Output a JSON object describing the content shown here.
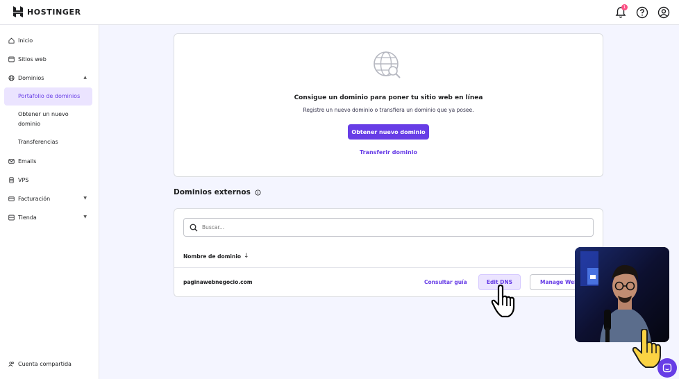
{
  "brand": {
    "name": "HOSTINGER"
  },
  "header": {
    "notification_count": "1",
    "icons": [
      "bell-icon",
      "help-icon",
      "account-icon"
    ]
  },
  "sidebar": {
    "items": [
      {
        "label": "Inicio",
        "icon": "home-icon"
      },
      {
        "label": "Sitios web",
        "icon": "browser-icon"
      },
      {
        "label": "Dominios",
        "icon": "globe-icon",
        "expanded": true
      },
      {
        "label": "Portafolio de dominios",
        "sub": true,
        "active": true
      },
      {
        "label": "Obtener un nuevo dominio",
        "sub": true
      },
      {
        "label": "Transferencias",
        "sub": true
      },
      {
        "label": "Emails",
        "icon": "mail-icon"
      },
      {
        "label": "VPS",
        "icon": "server-icon"
      },
      {
        "label": "Facturación",
        "icon": "billing-icon",
        "expandable": true
      },
      {
        "label": "Tienda",
        "icon": "store-icon",
        "expandable": true
      }
    ],
    "footer": {
      "label": "Cuenta compartida",
      "icon": "users-icon"
    }
  },
  "empty_state": {
    "title": "Consigue un dominio para poner tu sitio web en línea",
    "subtitle": "Registre un nuevo dominio o transfiera un dominio que ya posee.",
    "primary_button": "Obtener nuevo dominio",
    "secondary_link": "Transferir dominio"
  },
  "external_domains": {
    "title": "Dominios externos",
    "search_placeholder": "Buscar...",
    "column_header": "Nombre de dominio",
    "rows": [
      {
        "domain": "paginawebnegocio.com",
        "guide_link": "Consultar guía",
        "dns_button": "Edit DNS",
        "manage_button": "Manage Website"
      }
    ]
  },
  "colors": {
    "accent": "#673de6",
    "accent_light": "#ebe4ff",
    "background": "#f4f5ff",
    "notification": "#fc5185"
  }
}
